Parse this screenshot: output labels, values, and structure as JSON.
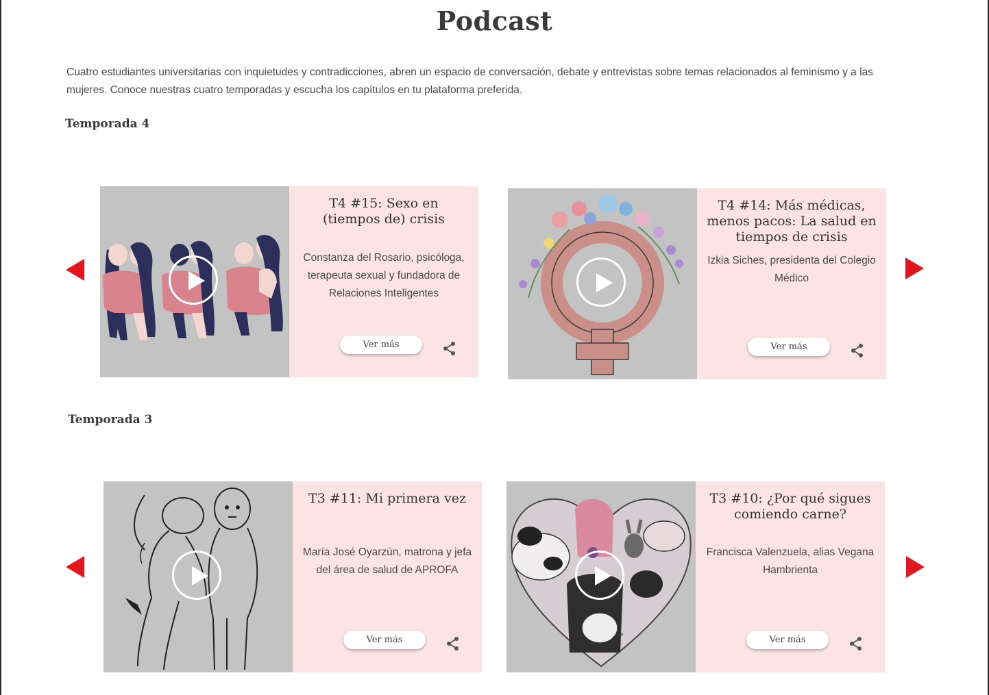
{
  "page": {
    "title": "Podcast",
    "intro": "Cuatro estudiantes universitarias con inquietudes y contradicciones, abren un espacio de conversación, debate y entrevistas sobre temas relacionados al feminismo y a las mujeres. Conoce nuestras cuatro temporadas y escucha los capítulos en tu plataforma preferida."
  },
  "theme": {
    "accent": "#e3161f",
    "card_bg": "#fce4e5",
    "media_bg": "#c3c3c3"
  },
  "seasons": [
    {
      "title": "Temporada 4",
      "episodes": [
        {
          "title": "T4 #15: Sexo en (tiempos de) crisis",
          "guest": "Constanza del Rosario, psicóloga, terapeuta sexual y fundadora de Relaciones Inteligentes",
          "button": "Ver más",
          "image": "three-couples-embracing-illustration"
        },
        {
          "title": "T4 #14: Más médicas, menos pacos: La salud en tiempos de crisis",
          "guest": "Izkia Siches, presidenta del Colegio Médico",
          "button": "Ver más",
          "image": "venus-symbol-fist-flowers-illustration"
        }
      ]
    },
    {
      "title": "Temporada 3",
      "episodes": [
        {
          "title": "T3 #11: Mi primera vez",
          "guest": "María José Oyarzún, matrona y jefa del área de salud de APROFA",
          "button": "Ver más",
          "image": "couple-line-drawing"
        },
        {
          "title": "T3 #10: ¿Por qué sigues comiendo carne?",
          "guest": "Francisca Valenzuela, alias Vegana Hambrienta",
          "button": "Ver más",
          "image": "heart-with-girl-and-animals-illustration",
          "image_signature": "JuNadas"
        }
      ]
    }
  ]
}
